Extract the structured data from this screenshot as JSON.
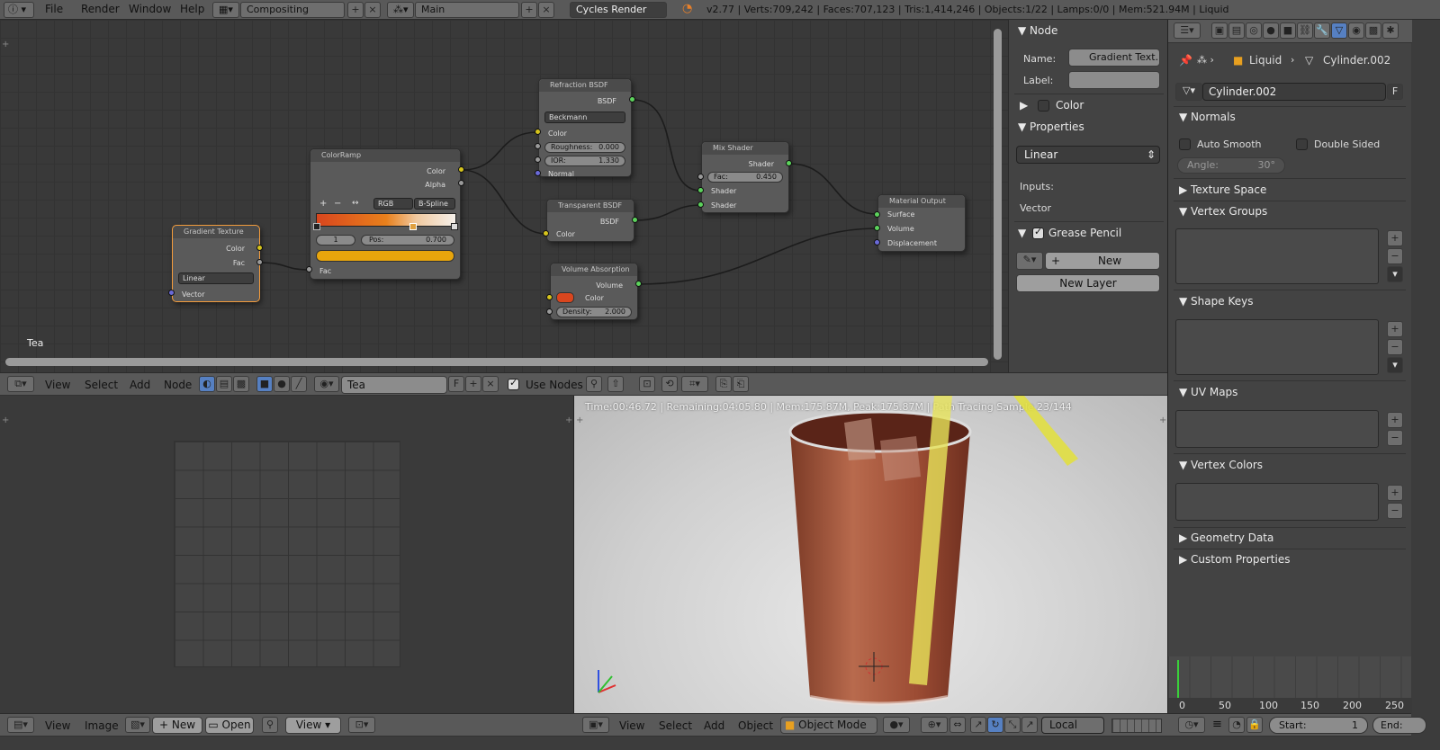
{
  "top": {
    "menus": [
      "File",
      "Render",
      "Window",
      "Help"
    ],
    "screen_layout": "Compositing",
    "scene": "Main",
    "engine": "Cycles Render",
    "stats": "v2.77 | Verts:709,242 | Faces:707,123 | Tris:1,414,246 | Objects:1/22 | Lamps:0/0 | Mem:521.94M | Liquid"
  },
  "node_editor": {
    "material_name": "Tea",
    "nodes": {
      "gradient": {
        "title": "Gradient Texture",
        "out_color": "Color",
        "out_fac": "Fac",
        "type": "Linear",
        "in_vector": "Vector"
      },
      "colorramp": {
        "title": "ColorRamp",
        "out_color": "Color",
        "out_alpha": "Alpha",
        "mode": "RGB",
        "interp": "B-Spline",
        "index": "1",
        "pos_label": "Pos:",
        "pos_value": "0.700",
        "in_fac": "Fac",
        "swatch": "#e8a50c"
      },
      "refraction": {
        "title": "Refraction BSDF",
        "out": "BSDF",
        "dist": "Beckmann",
        "in_color": "Color",
        "roughness_label": "Roughness:",
        "roughness": "0.000",
        "ior_label": "IOR:",
        "ior": "1.330",
        "in_normal": "Normal"
      },
      "transparent": {
        "title": "Transparent BSDF",
        "out": "BSDF",
        "in_color": "Color"
      },
      "volume": {
        "title": "Volume Absorption",
        "out": "Volume",
        "in_color": "Color",
        "color": "#d9461e",
        "density_label": "Density:",
        "density": "2.000"
      },
      "mix": {
        "title": "Mix Shader",
        "out": "Shader",
        "fac_label": "Fac:",
        "fac": "0.450",
        "in1": "Shader",
        "in2": "Shader"
      },
      "output": {
        "title": "Material Output",
        "surface": "Surface",
        "volume": "Volume",
        "displacement": "Displacement"
      }
    },
    "header": {
      "menus": [
        "View",
        "Select",
        "Add",
        "Node"
      ],
      "material": "Tea",
      "fake": "F",
      "use_nodes": "Use Nodes"
    }
  },
  "node_panel": {
    "node_heading": "Node",
    "name_label": "Name:",
    "name_value": "Gradient Text...",
    "label_label": "Label:",
    "color_heading": "Color",
    "properties_heading": "Properties",
    "interp_value": "Linear",
    "inputs_label": "Inputs:",
    "vector_label": "Vector",
    "grease_heading": "Grease Pencil",
    "new_button": "New",
    "new_layer_button": "New Layer"
  },
  "properties": {
    "breadcrumb_obj": "Liquid",
    "breadcrumb_mesh": "Cylinder.002",
    "mesh_name": "Cylinder.002",
    "fake": "F",
    "normals_heading": "Normals",
    "auto_smooth": "Auto Smooth",
    "double_sided": "Double Sided",
    "angle_label": "Angle:",
    "angle_value": "30°",
    "texture_space": "Texture Space",
    "vertex_groups": "Vertex Groups",
    "shape_keys": "Shape Keys",
    "uv_maps": "UV Maps",
    "vertex_colors": "Vertex Colors",
    "geometry_data": "Geometry Data",
    "custom_properties": "Custom Properties"
  },
  "image_editor": {
    "menus": [
      "View",
      "Image"
    ],
    "new": "New",
    "open": "Open",
    "view": "View"
  },
  "viewport": {
    "render_status": "Time:00:46.72 | Remaining:04:05.80 | Mem:175.87M, Peak:175.87M | Path Tracing Sample 23/144",
    "menus": [
      "View",
      "Select",
      "Add",
      "Object"
    ],
    "mode": "Object Mode",
    "pivot": "Local"
  },
  "timeline": {
    "ticks": [
      "0",
      "50",
      "100",
      "150",
      "200",
      "250"
    ],
    "start_label": "Start:",
    "start_value": "1",
    "end_label": "End:"
  },
  "colors": {
    "socket_yellow": "#d6c41c",
    "socket_gray": "#9a9a9a",
    "socket_green": "#5cd35c",
    "socket_blue": "#6a6ad8",
    "selected_border": "#f29b3c"
  }
}
